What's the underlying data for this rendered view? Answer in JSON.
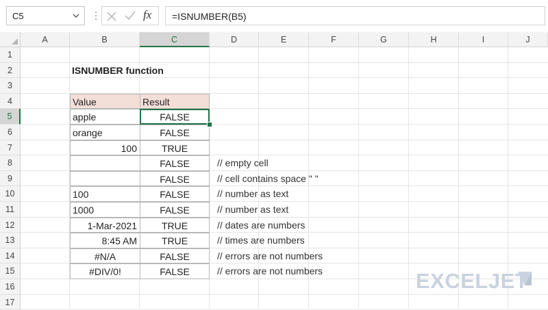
{
  "formula_bar": {
    "name_box": "C5",
    "fx_label": "fx",
    "formula": "=ISNUMBER(B5)"
  },
  "columns": [
    "A",
    "B",
    "C",
    "D",
    "E",
    "F",
    "G",
    "H",
    "I",
    "J"
  ],
  "rows": [
    "1",
    "2",
    "3",
    "4",
    "5",
    "6",
    "7",
    "8",
    "9",
    "10",
    "11",
    "12",
    "13",
    "14",
    "15",
    "16",
    "17"
  ],
  "selected": {
    "column": "C",
    "row": "5"
  },
  "sheet": {
    "title": "ISNUMBER function",
    "headers": {
      "value": "Value",
      "result": "Result"
    },
    "data": [
      {
        "value": "apple",
        "result": "FALSE",
        "note": ""
      },
      {
        "value": "orange",
        "result": "FALSE",
        "note": ""
      },
      {
        "value": "100",
        "result": "TRUE",
        "note": ""
      },
      {
        "value": "",
        "result": "FALSE",
        "note": "// empty cell"
      },
      {
        "value": "",
        "result": "FALSE",
        "note": "// cell contains space \" \""
      },
      {
        "value": "100",
        "result": "FALSE",
        "note": "// number as text"
      },
      {
        "value": "1000",
        "result": "FALSE",
        "note": "// number as text"
      },
      {
        "value": "1-Mar-2021",
        "result": "TRUE",
        "note": "// dates are numbers"
      },
      {
        "value": "8:45 AM",
        "result": "TRUE",
        "note": "// times are numbers"
      },
      {
        "value": "#N/A",
        "result": "FALSE",
        "note": "// errors are not numbers"
      },
      {
        "value": "#DIV/0!",
        "result": "FALSE",
        "note": "// errors are not numbers"
      }
    ]
  },
  "colors": {
    "header_fill": "#f4dfd8",
    "selection": "#217346"
  },
  "logo": {
    "text": "EXCELJET"
  }
}
